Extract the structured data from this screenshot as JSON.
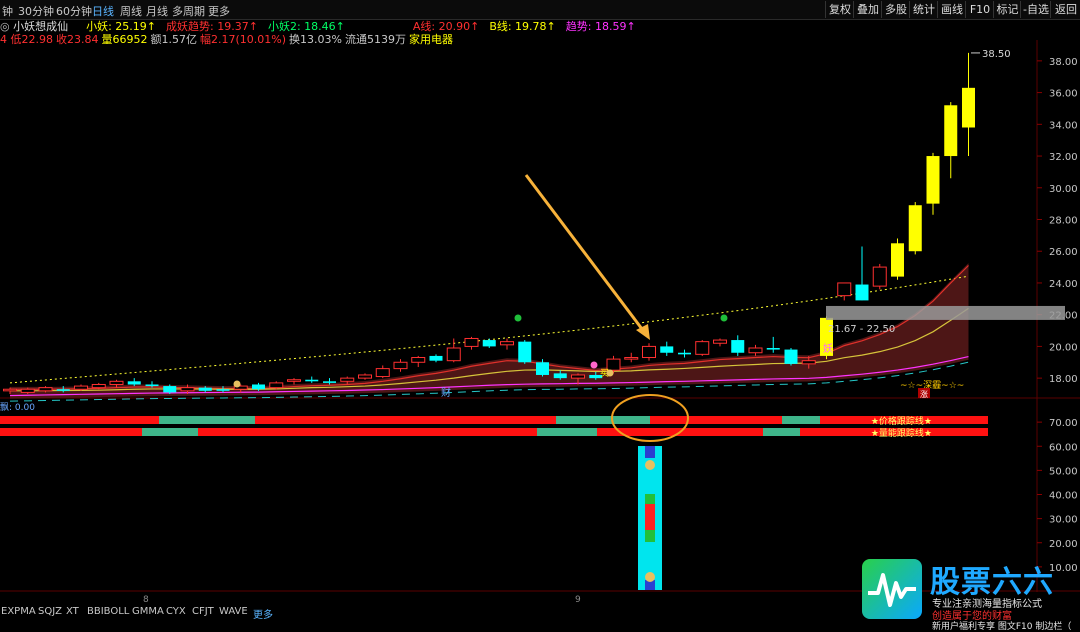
{
  "toolbar": {
    "periods": [
      "钟",
      "30分钟",
      "60分钟",
      "日线",
      "周线",
      "月线",
      "多周期",
      "更多"
    ],
    "active_period": "日线",
    "right_buttons": [
      "复权",
      "叠加",
      "多股",
      "统计",
      "画线",
      "F10",
      "标记",
      "-自选",
      "返回"
    ]
  },
  "stock": {
    "name": "小妖想成仙",
    "indicators": [
      {
        "label": "小妖: 25.19↑",
        "color": "#ffff00"
      },
      {
        "label": "成妖趋势: 19.37↑",
        "color": "#ff3030"
      },
      {
        "label": "小妖2: 18.46↑",
        "color": "#00ff66"
      },
      {
        "label": "A线: 20.90↑",
        "color": "#ff3030"
      },
      {
        "label": "B线: 19.78↑",
        "color": "#ffff00"
      },
      {
        "label": "趋势: 18.59↑",
        "color": "#ff33ff"
      }
    ]
  },
  "info": {
    "items": [
      {
        "label": "4 低22.98",
        "color": "#ff3030"
      },
      {
        "label": "收23.84",
        "color": "#ff3030"
      },
      {
        "label": "量66952",
        "color": "#ffff00"
      },
      {
        "label": "额1.57亿",
        "color": "#c8c8c8"
      },
      {
        "label": "幅2.17(10.01%)",
        "color": "#ff3030"
      },
      {
        "label": "换13.03%",
        "color": "#c8c8c8"
      },
      {
        "label": "流通5139万",
        "color": "#c8c8c8"
      },
      {
        "label": "家用电器",
        "color": "#ffff00"
      }
    ]
  },
  "colors": {
    "up": "#ff3030",
    "down": "#00ffff",
    "bull": "#ffff00",
    "ma_yellow": "#d6c33a",
    "ma_red": "#e0302a",
    "ma_magenta": "#ff33ff",
    "dotted": "#ffff33",
    "band": "#5a1a1a",
    "arrow": "#f7b23a"
  },
  "chart_data": [
    {
      "type": "candlestick",
      "title": "小妖想成仙",
      "ylim": [
        17,
        39
      ],
      "yticks": [
        "18.00",
        "20.00",
        "22.00",
        "24.00",
        "26.00",
        "28.00",
        "30.00",
        "32.00",
        "34.00",
        "36.00",
        "38.00"
      ],
      "x_labels": [
        "8",
        "9"
      ],
      "candles": [
        {
          "o": 17.2,
          "h": 17.4,
          "l": 17.0,
          "c": 17.3
        },
        {
          "o": 17.1,
          "h": 17.4,
          "l": 17.0,
          "c": 17.3
        },
        {
          "o": 17.2,
          "h": 17.5,
          "l": 17.1,
          "c": 17.4
        },
        {
          "o": 17.3,
          "h": 17.5,
          "l": 17.1,
          "c": 17.2
        },
        {
          "o": 17.3,
          "h": 17.6,
          "l": 17.2,
          "c": 17.5
        },
        {
          "o": 17.4,
          "h": 17.7,
          "l": 17.3,
          "c": 17.6
        },
        {
          "o": 17.6,
          "h": 17.9,
          "l": 17.4,
          "c": 17.8
        },
        {
          "o": 17.8,
          "h": 18.0,
          "l": 17.5,
          "c": 17.6
        },
        {
          "o": 17.6,
          "h": 17.8,
          "l": 17.4,
          "c": 17.5
        },
        {
          "o": 17.5,
          "h": 17.6,
          "l": 17.0,
          "c": 17.1
        },
        {
          "o": 17.2,
          "h": 17.6,
          "l": 17.0,
          "c": 17.4
        },
        {
          "o": 17.4,
          "h": 17.5,
          "l": 17.1,
          "c": 17.2
        },
        {
          "o": 17.3,
          "h": 17.5,
          "l": 17.1,
          "c": 17.2
        },
        {
          "o": 17.3,
          "h": 17.6,
          "l": 17.1,
          "c": 17.5
        },
        {
          "o": 17.6,
          "h": 17.7,
          "l": 17.2,
          "c": 17.3
        },
        {
          "o": 17.4,
          "h": 17.8,
          "l": 17.3,
          "c": 17.7
        },
        {
          "o": 17.8,
          "h": 18.0,
          "l": 17.6,
          "c": 17.9
        },
        {
          "o": 17.9,
          "h": 18.1,
          "l": 17.7,
          "c": 17.8
        },
        {
          "o": 17.8,
          "h": 18.0,
          "l": 17.6,
          "c": 17.7
        },
        {
          "o": 17.8,
          "h": 18.1,
          "l": 17.6,
          "c": 18.0
        },
        {
          "o": 18.0,
          "h": 18.3,
          "l": 17.9,
          "c": 18.2
        },
        {
          "o": 18.1,
          "h": 18.8,
          "l": 18.0,
          "c": 18.6
        },
        {
          "o": 18.6,
          "h": 19.2,
          "l": 18.4,
          "c": 19.0
        },
        {
          "o": 19.0,
          "h": 19.4,
          "l": 18.7,
          "c": 19.3
        },
        {
          "o": 19.4,
          "h": 19.5,
          "l": 19.0,
          "c": 19.1
        },
        {
          "o": 19.1,
          "h": 20.5,
          "l": 19.0,
          "c": 19.9
        },
        {
          "o": 20.0,
          "h": 20.6,
          "l": 19.8,
          "c": 20.5
        },
        {
          "o": 20.4,
          "h": 20.5,
          "l": 19.9,
          "c": 20.0
        },
        {
          "o": 20.1,
          "h": 20.5,
          "l": 19.8,
          "c": 20.3
        },
        {
          "o": 20.3,
          "h": 20.4,
          "l": 18.9,
          "c": 19.0
        },
        {
          "o": 19.0,
          "h": 19.2,
          "l": 18.1,
          "c": 18.2
        },
        {
          "o": 18.3,
          "h": 18.5,
          "l": 17.9,
          "c": 18.0
        },
        {
          "o": 18.0,
          "h": 18.3,
          "l": 17.6,
          "c": 18.2
        },
        {
          "o": 18.2,
          "h": 18.4,
          "l": 17.9,
          "c": 18.0
        },
        {
          "o": 18.5,
          "h": 19.4,
          "l": 18.3,
          "c": 19.2
        },
        {
          "o": 19.2,
          "h": 19.6,
          "l": 19.0,
          "c": 19.3
        },
        {
          "o": 19.3,
          "h": 20.2,
          "l": 19.1,
          "c": 20.0
        },
        {
          "o": 20.0,
          "h": 20.3,
          "l": 19.4,
          "c": 19.6
        },
        {
          "o": 19.6,
          "h": 19.8,
          "l": 19.3,
          "c": 19.5
        },
        {
          "o": 19.5,
          "h": 20.4,
          "l": 19.4,
          "c": 20.3
        },
        {
          "o": 20.2,
          "h": 20.5,
          "l": 20.0,
          "c": 20.4
        },
        {
          "o": 20.4,
          "h": 20.7,
          "l": 19.4,
          "c": 19.6
        },
        {
          "o": 19.6,
          "h": 20.1,
          "l": 19.4,
          "c": 19.9
        },
        {
          "o": 19.9,
          "h": 20.6,
          "l": 19.6,
          "c": 19.8
        },
        {
          "o": 19.8,
          "h": 19.9,
          "l": 18.8,
          "c": 18.9
        },
        {
          "o": 18.9,
          "h": 19.4,
          "l": 18.6,
          "c": 19.1
        },
        {
          "o": 19.4,
          "h": 21.9,
          "l": 19.2,
          "c": 21.8
        },
        {
          "o": 23.2,
          "h": 24.0,
          "l": 22.9,
          "c": 24.0
        },
        {
          "o": 23.9,
          "h": 26.3,
          "l": 22.9,
          "c": 22.9
        },
        {
          "o": 23.8,
          "h": 25.2,
          "l": 23.6,
          "c": 25.0
        },
        {
          "o": 24.4,
          "h": 26.8,
          "l": 24.2,
          "c": 26.5
        },
        {
          "o": 26.0,
          "h": 29.1,
          "l": 25.8,
          "c": 28.9
        },
        {
          "o": 29.0,
          "h": 32.2,
          "l": 28.3,
          "c": 32.0
        },
        {
          "o": 32.0,
          "h": 35.4,
          "l": 30.6,
          "c": 35.2
        },
        {
          "o": 33.8,
          "h": 38.5,
          "l": 32.0,
          "c": 36.3
        }
      ],
      "series": [
        {
          "name": "A线",
          "values": [
            17.3,
            17.3,
            17.3,
            17.31,
            17.33,
            17.35,
            17.4,
            17.44,
            17.45,
            17.41,
            17.4,
            17.37,
            17.35,
            17.36,
            17.35,
            17.39,
            17.47,
            17.52,
            17.55,
            17.6,
            17.67,
            17.8,
            17.96,
            18.15,
            18.3,
            18.5,
            18.75,
            18.93,
            19.1,
            19.07,
            18.9,
            18.72,
            18.6,
            18.48,
            18.57,
            18.65,
            18.8,
            18.88,
            18.93,
            19.05,
            19.17,
            19.23,
            19.3,
            19.36,
            19.31,
            19.29,
            19.55,
            20.05,
            20.35,
            20.75,
            21.25,
            21.95,
            22.85,
            24.0,
            25.1
          ]
        },
        {
          "name": "B线",
          "values": [
            17.2,
            17.2,
            17.21,
            17.22,
            17.23,
            17.24,
            17.27,
            17.3,
            17.32,
            17.32,
            17.32,
            17.31,
            17.3,
            17.3,
            17.3,
            17.32,
            17.36,
            17.4,
            17.42,
            17.46,
            17.5,
            17.57,
            17.66,
            17.77,
            17.87,
            18.0,
            18.16,
            18.3,
            18.43,
            18.51,
            18.52,
            18.49,
            18.46,
            18.42,
            18.43,
            18.46,
            18.52,
            18.56,
            18.61,
            18.68,
            18.75,
            18.81,
            18.86,
            18.92,
            18.93,
            18.95,
            19.06,
            19.29,
            19.45,
            19.67,
            19.96,
            20.37,
            20.92,
            21.65,
            22.4
          ]
        },
        {
          "name": "趋势",
          "values": [
            16.9,
            16.92,
            16.94,
            16.96,
            16.98,
            17.0,
            17.02,
            17.04,
            17.06,
            17.07,
            17.08,
            17.09,
            17.1,
            17.11,
            17.12,
            17.14,
            17.16,
            17.18,
            17.2,
            17.22,
            17.25,
            17.28,
            17.32,
            17.36,
            17.4,
            17.45,
            17.5,
            17.55,
            17.59,
            17.62,
            17.64,
            17.65,
            17.67,
            17.68,
            17.7,
            17.72,
            17.75,
            17.78,
            17.8,
            17.83,
            17.86,
            17.89,
            17.92,
            17.95,
            17.97,
            17.99,
            18.05,
            18.15,
            18.25,
            18.37,
            18.51,
            18.68,
            18.88,
            19.11,
            19.36
          ]
        }
      ],
      "price_labels": [
        "38.50",
        "21.67 - 22.50"
      ],
      "annotations": [
        "财",
        "买",
        "妖",
        "~☆~深霾~☆~",
        "涨"
      ]
    },
    {
      "type": "heatmap",
      "title": "飘",
      "value_label": "0.00",
      "ylim": [
        0,
        80
      ],
      "yticks": [
        "10.00",
        "20.00",
        "30.00",
        "40.00",
        "50.00",
        "60.00",
        "70.00"
      ],
      "rows": [
        {
          "name": "★价格跟踪线★",
          "bands": [
            [
              "red",
              0,
              159
            ],
            [
              "green",
              159,
              255
            ],
            [
              "red",
              255,
              556
            ],
            [
              "green",
              556,
              650
            ],
            [
              "red",
              650,
              782
            ],
            [
              "green",
              782,
              820
            ],
            [
              "red",
              820,
              988
            ]
          ]
        },
        {
          "name": "★量能跟踪线★",
          "bands": [
            [
              "red",
              0,
              142
            ],
            [
              "green",
              142,
              198
            ],
            [
              "red",
              198,
              537
            ],
            [
              "green",
              537,
              597
            ],
            [
              "red",
              597,
              763
            ],
            [
              "green",
              763,
              800
            ],
            [
              "red",
              800,
              988
            ]
          ]
        }
      ]
    }
  ],
  "bottom_tabs": [
    "EXPMA",
    "SQJZ",
    "XT",
    "BBIBOLL",
    "GMMA",
    "CYX",
    "CFJT",
    "WAVE",
    "更多"
  ],
  "watermark": {
    "title": "股票六六",
    "line1": "专业注亲测海量指标公式",
    "line2": "创造属于您的财富",
    "line3": "新用户福利专享 图文F10 制边栏（"
  }
}
